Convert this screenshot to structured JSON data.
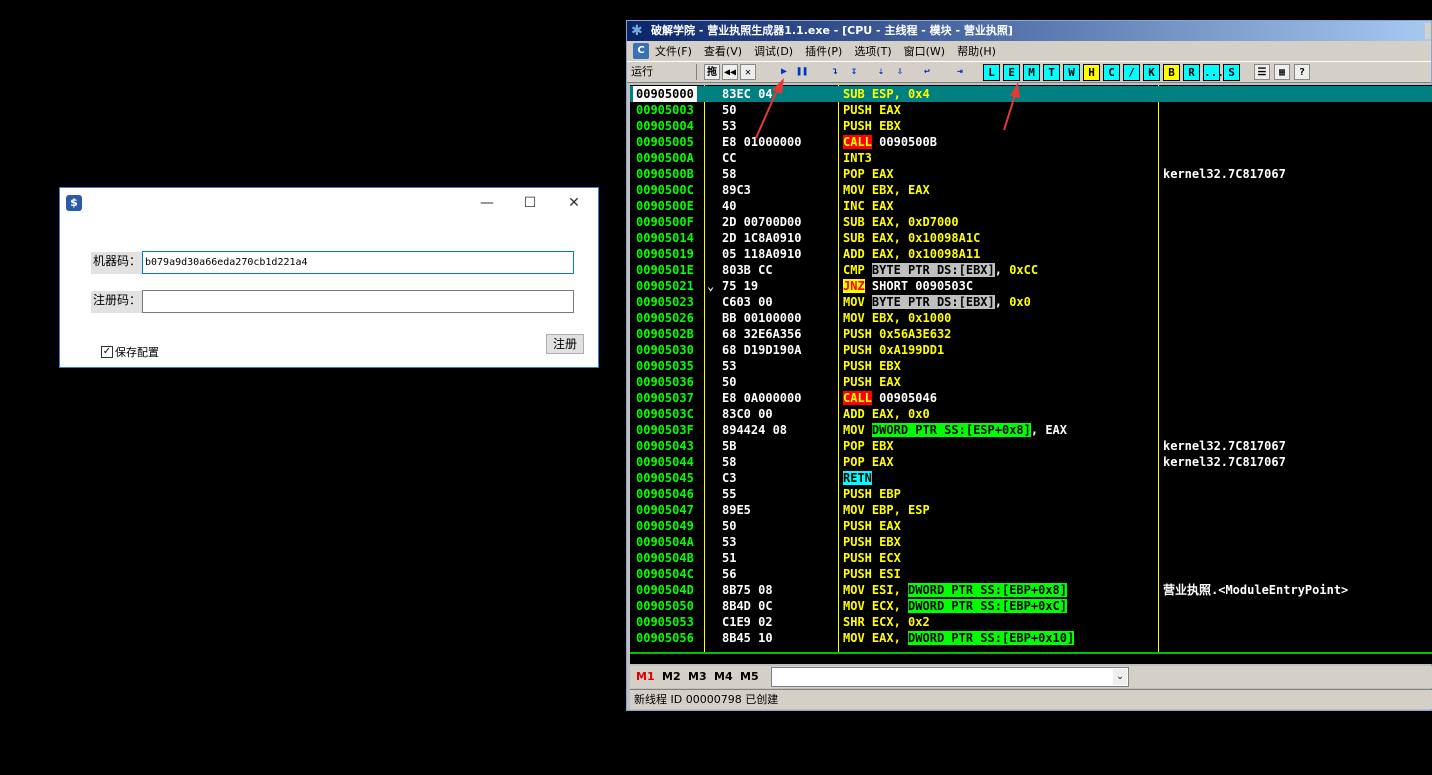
{
  "dialog": {
    "app_icon": "$",
    "min_icon": "—",
    "max_icon": "☐",
    "close_icon": "✕",
    "machine_label": "机器码：",
    "machine_value": "b079a9d30a66eda270cb1d221a4",
    "reg_label": "注册码：",
    "reg_value": "",
    "save_checkbox": "保存配置",
    "register_button": "注册"
  },
  "debugger": {
    "title": "破解学院 - 营业执照生成器1.1.exe - [CPU - 主线程 - 模块 - 营业执照]",
    "menu": [
      "文件(F)",
      "查看(V)",
      "调试(D)",
      "插件(P)",
      "选项(T)",
      "窗口(W)",
      "帮助(H)"
    ],
    "menu_logo": "C",
    "toolbar_status": "运行",
    "toolbar_buttons": [
      "拖",
      "◀◀",
      "✕",
      "▶",
      "❚❚",
      "↴",
      "↧",
      "⇣",
      "⇩",
      "↩",
      "⇥"
    ],
    "window_buttons": [
      "L",
      "E",
      "M",
      "T",
      "W",
      "H",
      "C",
      "/",
      "K",
      "B",
      "R",
      "...",
      "S"
    ],
    "layout_buttons": [
      "☰",
      "▦",
      "?"
    ],
    "rows": [
      {
        "addr": "00905000",
        "hex": "83EC 04",
        "mn": "SUB",
        "ops": [
          {
            "t": "ESP, ",
            "c": "opg"
          },
          {
            "t": "0x4",
            "c": "opg"
          }
        ],
        "cmt": "",
        "sel": true
      },
      {
        "addr": "00905003",
        "hex": "50",
        "mn": "PUSH",
        "ops": [
          {
            "t": "EAX",
            "c": "opg"
          }
        ],
        "cmt": ""
      },
      {
        "addr": "00905004",
        "hex": "53",
        "mn": "PUSH",
        "ops": [
          {
            "t": "EBX",
            "c": "opg"
          }
        ],
        "cmt": ""
      },
      {
        "addr": "00905005",
        "hex": "E8 01000000",
        "mn": "CALL",
        "mnc": "call",
        "ops": [
          {
            "t": "0090500B",
            "c": "opw"
          }
        ],
        "cmt": ""
      },
      {
        "addr": "0090500A",
        "hex": "CC",
        "mn": "INT3",
        "ops": [],
        "cmt": ""
      },
      {
        "addr": "0090500B",
        "hex": "58",
        "mn": "POP",
        "ops": [
          {
            "t": "EAX",
            "c": "opg"
          }
        ],
        "cmt": "kernel32.7C817067"
      },
      {
        "addr": "0090500C",
        "hex": "89C3",
        "mn": "MOV",
        "ops": [
          {
            "t": "EBX, EAX",
            "c": "opg"
          }
        ],
        "cmt": ""
      },
      {
        "addr": "0090500E",
        "hex": "40",
        "mn": "INC",
        "ops": [
          {
            "t": "EAX",
            "c": "opg"
          }
        ],
        "cmt": ""
      },
      {
        "addr": "0090500F",
        "hex": "2D 00700D00",
        "mn": "SUB",
        "ops": [
          {
            "t": "EAX, 0xD7000",
            "c": "opg"
          }
        ],
        "cmt": ""
      },
      {
        "addr": "00905014",
        "hex": "2D 1C8A0910",
        "mn": "SUB",
        "ops": [
          {
            "t": "EAX, 0x10098A1C",
            "c": "opg"
          }
        ],
        "cmt": ""
      },
      {
        "addr": "00905019",
        "hex": "05 118A0910",
        "mn": "ADD",
        "ops": [
          {
            "t": "EAX, 0x10098A11",
            "c": "opg"
          }
        ],
        "cmt": ""
      },
      {
        "addr": "0090501E",
        "hex": "803B CC",
        "mn": "CMP",
        "ops": [
          {
            "t": "BYTE PTR DS:[EBX]",
            "c": "mem-gray"
          },
          {
            "t": ", ",
            "c": "opw"
          },
          {
            "t": "0xCC",
            "c": "opg"
          }
        ],
        "cmt": ""
      },
      {
        "addr": "00905021",
        "jmp": "⌄",
        "hex": "75 19",
        "mn": "JNZ",
        "mnc": "jnz",
        "ops": [
          {
            "t": "SHORT 0090503C",
            "c": "opw"
          }
        ],
        "cmt": ""
      },
      {
        "addr": "00905023",
        "hex": "C603 00",
        "mn": "MOV",
        "ops": [
          {
            "t": "BYTE PTR DS:[EBX]",
            "c": "mem-gray"
          },
          {
            "t": ", ",
            "c": "opw"
          },
          {
            "t": "0x0",
            "c": "opg"
          }
        ],
        "cmt": ""
      },
      {
        "addr": "00905026",
        "hex": "BB 00100000",
        "mn": "MOV",
        "ops": [
          {
            "t": "EBX, 0x1000",
            "c": "opg"
          }
        ],
        "cmt": ""
      },
      {
        "addr": "0090502B",
        "hex": "68 32E6A356",
        "mn": "PUSH",
        "ops": [
          {
            "t": "0x56A3E632",
            "c": "opg"
          }
        ],
        "cmt": ""
      },
      {
        "addr": "00905030",
        "hex": "68 D19D190A",
        "mn": "PUSH",
        "ops": [
          {
            "t": "0xA199DD1",
            "c": "opg"
          }
        ],
        "cmt": ""
      },
      {
        "addr": "00905035",
        "hex": "53",
        "mn": "PUSH",
        "ops": [
          {
            "t": "EBX",
            "c": "opg"
          }
        ],
        "cmt": ""
      },
      {
        "addr": "00905036",
        "hex": "50",
        "mn": "PUSH",
        "ops": [
          {
            "t": "EAX",
            "c": "opg"
          }
        ],
        "cmt": ""
      },
      {
        "addr": "00905037",
        "hex": "E8 0A000000",
        "mn": "CALL",
        "mnc": "call",
        "ops": [
          {
            "t": "00905046",
            "c": "opw"
          }
        ],
        "cmt": ""
      },
      {
        "addr": "0090503C",
        "hex": "83C0 00",
        "mn": "ADD",
        "ops": [
          {
            "t": "EAX, 0x0",
            "c": "opg"
          }
        ],
        "cmt": ""
      },
      {
        "addr": "0090503F",
        "hex": "894424 08",
        "mn": "MOV",
        "ops": [
          {
            "t": "DWORD PTR SS:[ESP+0x8]",
            "c": "mem-green"
          },
          {
            "t": ", EAX",
            "c": "opw"
          }
        ],
        "cmt": ""
      },
      {
        "addr": "00905043",
        "hex": "5B",
        "mn": "POP",
        "ops": [
          {
            "t": "EBX",
            "c": "opg"
          }
        ],
        "cmt": "kernel32.7C817067"
      },
      {
        "addr": "00905044",
        "hex": "58",
        "mn": "POP",
        "ops": [
          {
            "t": "EAX",
            "c": "opg"
          }
        ],
        "cmt": "kernel32.7C817067"
      },
      {
        "addr": "00905045",
        "hex": "C3",
        "mn": "RETN",
        "mnc": "retn",
        "ops": [],
        "cmt": ""
      },
      {
        "addr": "00905046",
        "hex": "55",
        "mn": "PUSH",
        "ops": [
          {
            "t": "EBP",
            "c": "opg"
          }
        ],
        "cmt": ""
      },
      {
        "addr": "00905047",
        "hex": "89E5",
        "mn": "MOV",
        "ops": [
          {
            "t": "EBP, ESP",
            "c": "opg"
          }
        ],
        "cmt": ""
      },
      {
        "addr": "00905049",
        "hex": "50",
        "mn": "PUSH",
        "ops": [
          {
            "t": "EAX",
            "c": "opg"
          }
        ],
        "cmt": ""
      },
      {
        "addr": "0090504A",
        "hex": "53",
        "mn": "PUSH",
        "ops": [
          {
            "t": "EBX",
            "c": "opg"
          }
        ],
        "cmt": ""
      },
      {
        "addr": "0090504B",
        "hex": "51",
        "mn": "PUSH",
        "ops": [
          {
            "t": "ECX",
            "c": "opg"
          }
        ],
        "cmt": ""
      },
      {
        "addr": "0090504C",
        "hex": "56",
        "mn": "PUSH",
        "ops": [
          {
            "t": "ESI",
            "c": "opg"
          }
        ],
        "cmt": ""
      },
      {
        "addr": "0090504D",
        "hex": "8B75 08",
        "mn": "MOV",
        "ops": [
          {
            "t": "ESI, ",
            "c": "opg"
          },
          {
            "t": "DWORD PTR SS:[EBP+0x8]",
            "c": "mem-green"
          }
        ],
        "cmt": "营业执照.<ModuleEntryPoint>"
      },
      {
        "addr": "00905050",
        "hex": "8B4D 0C",
        "mn": "MOV",
        "ops": [
          {
            "t": "ECX, ",
            "c": "opg"
          },
          {
            "t": "DWORD PTR SS:[EBP+0xC]",
            "c": "mem-green"
          }
        ],
        "cmt": ""
      },
      {
        "addr": "00905053",
        "hex": "C1E9 02",
        "mn": "SHR",
        "ops": [
          {
            "t": "ECX, 0x2",
            "c": "opg"
          }
        ],
        "cmt": ""
      },
      {
        "addr": "00905056",
        "hex": "8B45 10",
        "mn": "MOV",
        "ops": [
          {
            "t": "EAX, ",
            "c": "opg"
          },
          {
            "t": "DWORD PTR SS:[EBP+0x10]",
            "c": "mem-green"
          }
        ],
        "cmt": ""
      }
    ],
    "command_buttons": [
      "M1",
      "M2",
      "M3",
      "M4",
      "M5"
    ],
    "command_dropdown_icon": "⌄",
    "status": "新线程 ID 00000798 已创建"
  },
  "colors": {
    "address": "#00ff00",
    "mnemonic": "#ffff00",
    "selected_row": "#008080",
    "annotation_arrow": "#e53935"
  }
}
